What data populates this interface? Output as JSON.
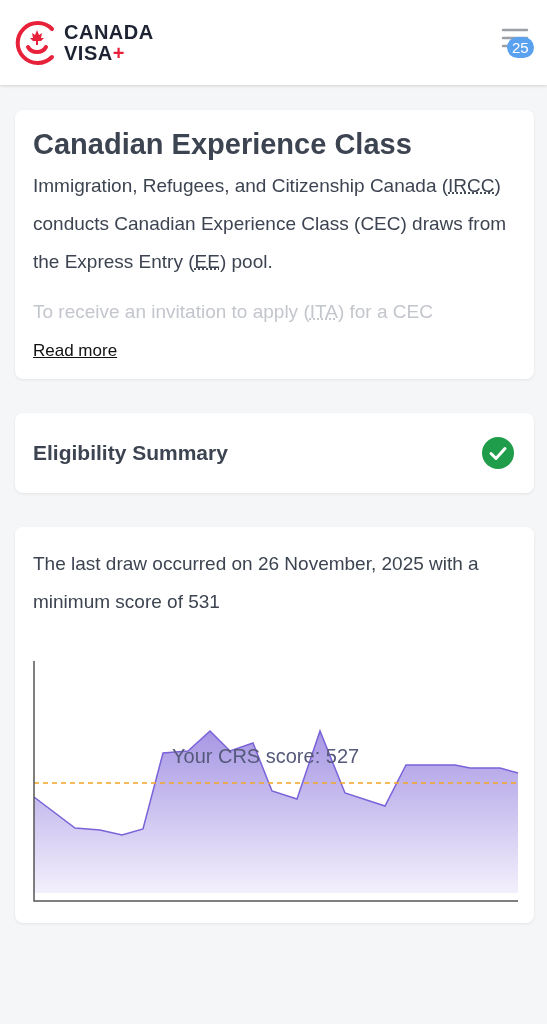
{
  "header": {
    "logo": {
      "line1": "CANADA",
      "line2": "VISA",
      "mark": "+"
    },
    "menu_badge": "25"
  },
  "intro": {
    "title": "Canadian Experience Class",
    "paragraph": [
      {
        "kind": "text",
        "text": "Immigration, Refugees, and Citizenship Canada ("
      },
      {
        "kind": "abbr",
        "text": "IRCC"
      },
      {
        "kind": "text",
        "text": ") conducts Canadian Experience Class (CEC) draws from the Express Entry ("
      },
      {
        "kind": "abbr",
        "text": "EE"
      },
      {
        "kind": "text",
        "text": ") pool."
      }
    ],
    "faded": [
      {
        "kind": "text",
        "text": "To receive an invitation to apply ("
      },
      {
        "kind": "abbr",
        "text": "ITA"
      },
      {
        "kind": "text",
        "text": ") for a CEC"
      }
    ],
    "read_more": "Read more"
  },
  "eligibility": {
    "title": "Eligibility Summary",
    "eligible": true
  },
  "draw": {
    "text": "The last draw occurred on 26 November, 2025 with a minimum score of 531",
    "score_label": "Your CRS score: 527"
  }
}
